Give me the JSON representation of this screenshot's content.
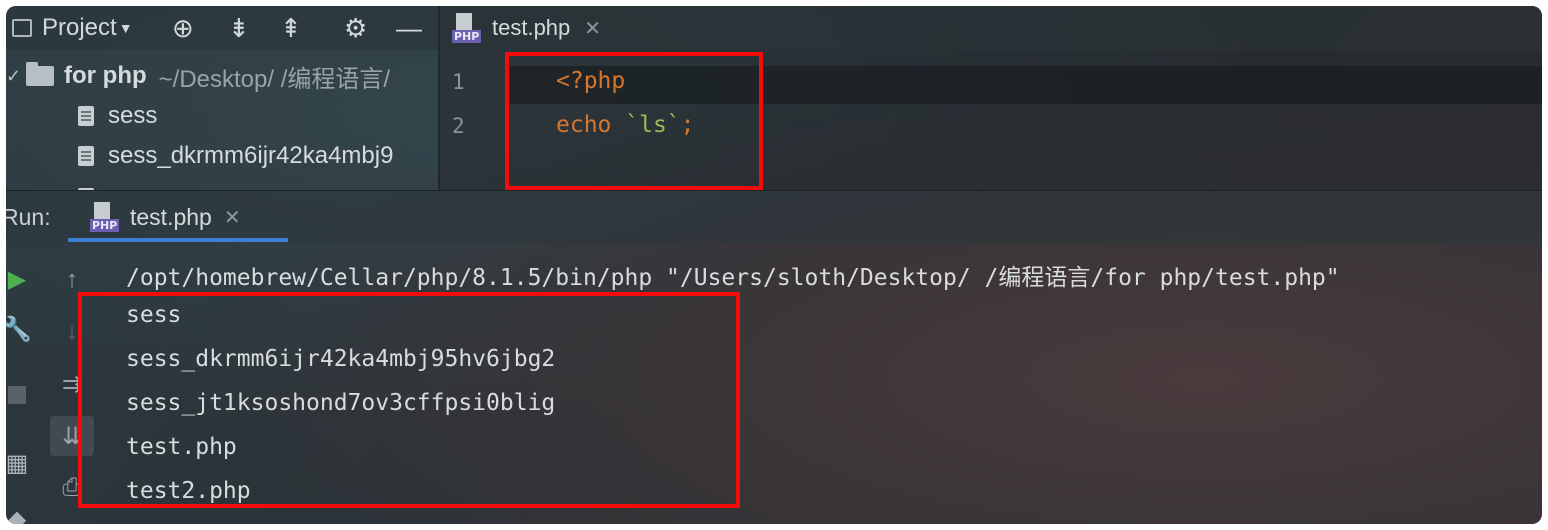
{
  "project_panel": {
    "title": "Project",
    "dropdown_icon": "caret-down-icon",
    "toolbar_icons": [
      "crosshair-icon",
      "expand-all-icon",
      "collapse-all-icon",
      "gear-icon",
      "minimize-icon"
    ],
    "root": {
      "name": "for php",
      "path": "~/Desktop/ /编程语言/"
    },
    "files": [
      "sess",
      "sess_dkrmm6ijr42ka4mbj9"
    ]
  },
  "editor": {
    "tab_label": "test.php",
    "tab_icon_badge": "PHP",
    "line_numbers": [
      "1",
      "2"
    ],
    "lines": {
      "l1": "<?php",
      "l2_kw": "echo ",
      "l2_bt": "`ls`",
      "l2_pn": ";"
    }
  },
  "run_panel": {
    "label": "Run:",
    "tab_label": "test.php",
    "tab_icon_badge": "PHP",
    "accent_color": "#3d7fd0"
  },
  "console": {
    "command": "/opt/homebrew/Cellar/php/8.1.5/bin/php \"/Users/sloth/Desktop/ /编程语言/for php/test.php\"",
    "output": [
      "sess",
      "sess_dkrmm6ijr42ka4mbj95hv6jbg2",
      "sess_jt1ksoshond7ov3cffpsi0blig",
      "test.php",
      "test2.php"
    ]
  },
  "colors": {
    "highlight_box": "#f20d0d",
    "keyword": "#d9762e",
    "backtick_string": "#9fb85a"
  }
}
